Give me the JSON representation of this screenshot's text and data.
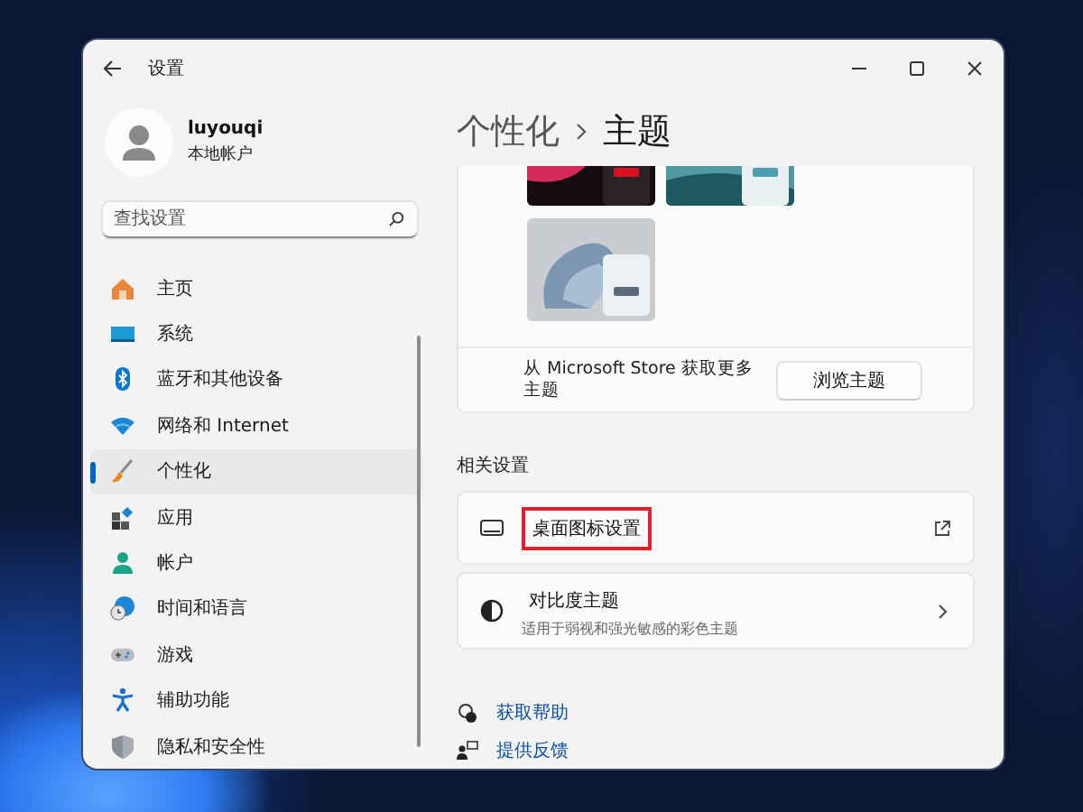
{
  "window": {
    "title": "设置"
  },
  "profile": {
    "name": "luyouqi",
    "account": "本地帐户"
  },
  "search": {
    "placeholder": "查找设置"
  },
  "sidebar": {
    "items": [
      {
        "label": "主页",
        "selected": false
      },
      {
        "label": "系统",
        "selected": false
      },
      {
        "label": "蓝牙和其他设备",
        "selected": false
      },
      {
        "label": "网络和 Internet",
        "selected": false
      },
      {
        "label": "个性化",
        "selected": true
      },
      {
        "label": "应用",
        "selected": false
      },
      {
        "label": "帐户",
        "selected": false
      },
      {
        "label": "时间和语言",
        "selected": false
      },
      {
        "label": "游戏",
        "selected": false
      },
      {
        "label": "辅助功能",
        "selected": false
      },
      {
        "label": "隐私和安全性",
        "selected": false
      }
    ]
  },
  "breadcrumb": [
    "个性化",
    "主题"
  ],
  "themes": [
    {
      "kind": "picture"
    },
    {
      "kind": "picture"
    },
    {
      "kind": "picture"
    }
  ],
  "store": {
    "text": "从 Microsoft Store 获取更多主题",
    "button": "浏览主题"
  },
  "related": {
    "heading": "相关设置",
    "items": [
      {
        "kind": "external",
        "title": "桌面图标设置",
        "highlighted": true
      },
      {
        "kind": "nav",
        "title": "对比度主题",
        "subtitle": "适用于弱视和强光敏感的彩色主题",
        "highlighted": false
      }
    ]
  },
  "links": [
    {
      "kind": "help",
      "label": "获取帮助"
    },
    {
      "kind": "feedback",
      "label": "提供反馈"
    }
  ]
}
